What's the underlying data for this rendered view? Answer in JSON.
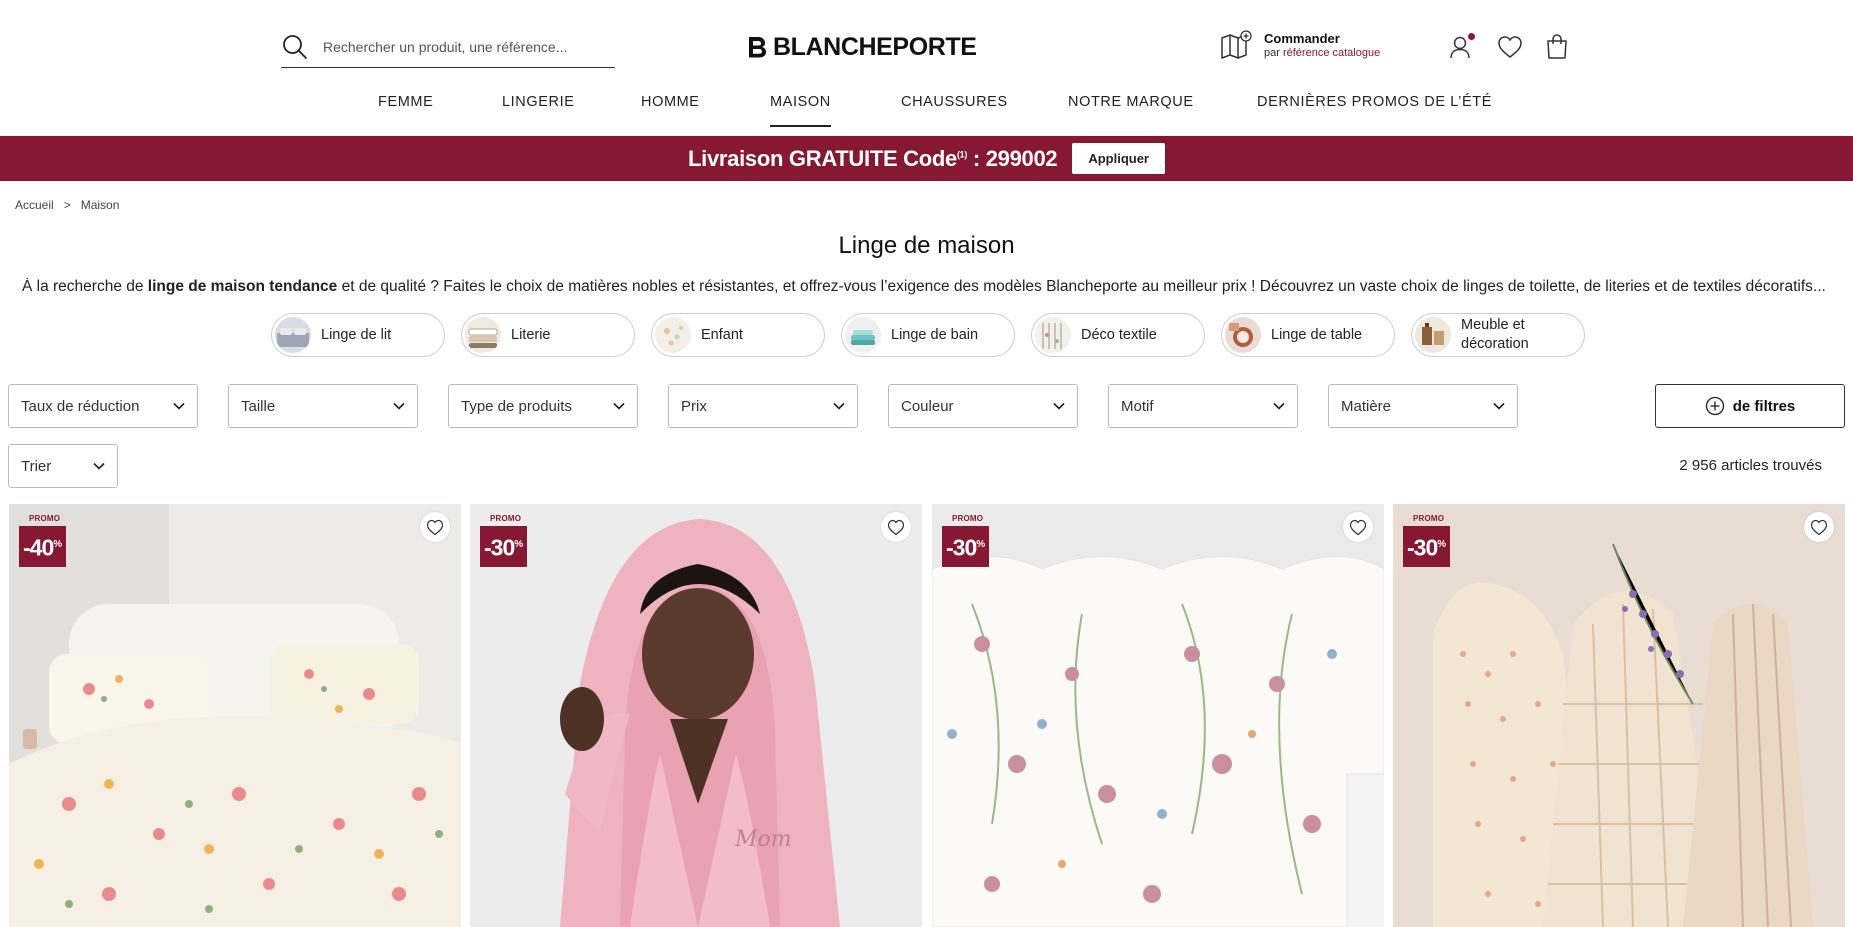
{
  "header": {
    "search_placeholder": "Rechercher un produit, une référence...",
    "logo_text": "BLANCHEPORTE",
    "order_title": "Commander",
    "order_sub_prefix": "par",
    "order_sub_link": "référence catalogue"
  },
  "nav": [
    {
      "label": "FEMME"
    },
    {
      "label": "LINGERIE"
    },
    {
      "label": "HOMME"
    },
    {
      "label": "MAISON"
    },
    {
      "label": "CHAUSSURES"
    },
    {
      "label": "NOTRE MARQUE"
    },
    {
      "label": "DERNIÈRES PROMOS DE L’ÉTÉ"
    }
  ],
  "banner": {
    "text_main": "Livraison GRATUITE Code",
    "text_sup": "(1)",
    "text_code": " : 299002",
    "button": "Appliquer",
    "color": "#861833"
  },
  "breadcrumb": {
    "home": "Accueil",
    "separator": ">",
    "current": "Maison"
  },
  "page": {
    "title": "Linge de maison",
    "intro_1": "À la recherche de ",
    "intro_bold": "linge de maison tendance",
    "intro_2": " et de qualité ? Faites le choix de matières nobles et résistantes, et offrez-vous l’exigence des modèles Blancheporte au meilleur prix ! Découvrez un vaste choix de linges de toilette, de literies et de textiles décoratifs..."
  },
  "categories": [
    {
      "label": "Linge de lit"
    },
    {
      "label": "Literie"
    },
    {
      "label": "Enfant"
    },
    {
      "label": "Linge de bain"
    },
    {
      "label": "Déco textile"
    },
    {
      "label": "Linge de table"
    },
    {
      "label": "Meuble et décoration"
    }
  ],
  "filters": [
    {
      "label": "Taux de réduction"
    },
    {
      "label": "Taille"
    },
    {
      "label": "Type de produits"
    },
    {
      "label": "Prix"
    },
    {
      "label": "Couleur"
    },
    {
      "label": "Motif"
    },
    {
      "label": "Matière"
    }
  ],
  "more_filters": "de filtres",
  "sort": "Trier",
  "results_count": "2 956 articles trouvés",
  "products": [
    {
      "promo": "PROMO",
      "discount": "-40",
      "pct": "%"
    },
    {
      "promo": "PROMO",
      "discount": "-30",
      "pct": "%"
    },
    {
      "promo": "PROMO",
      "discount": "-30",
      "pct": "%"
    },
    {
      "promo": "PROMO",
      "discount": "-30",
      "pct": "%"
    }
  ],
  "product_text": {
    "robe_embroidery": "Mom"
  }
}
